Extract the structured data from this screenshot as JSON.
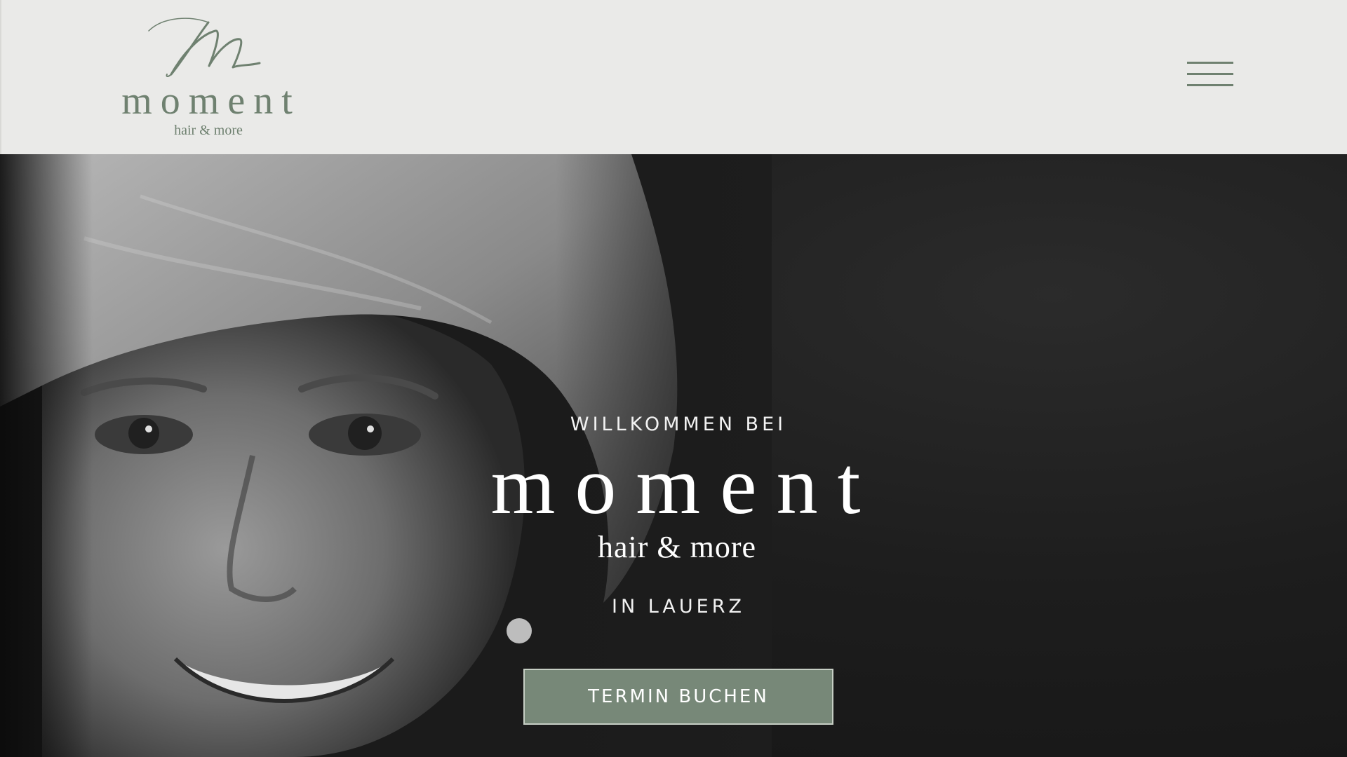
{
  "header": {
    "logo": {
      "word": "moment",
      "tagline": "hair & more",
      "mark_icon": "script-m-monogram-icon"
    },
    "menu_icon": "hamburger-menu-icon"
  },
  "hero": {
    "kicker": "WILLKOMMEN BEI",
    "brand_word": "moment",
    "brand_tagline": "hair & more",
    "location": "IN LAUERZ",
    "cta_label": "TERMIN BUCHEN"
  },
  "colors": {
    "header_bg": "#eaeae8",
    "brand_green": "#6f8170",
    "cta_bg": "#778878",
    "hero_bg": "#1d1d1d",
    "hero_text": "#ffffff"
  }
}
